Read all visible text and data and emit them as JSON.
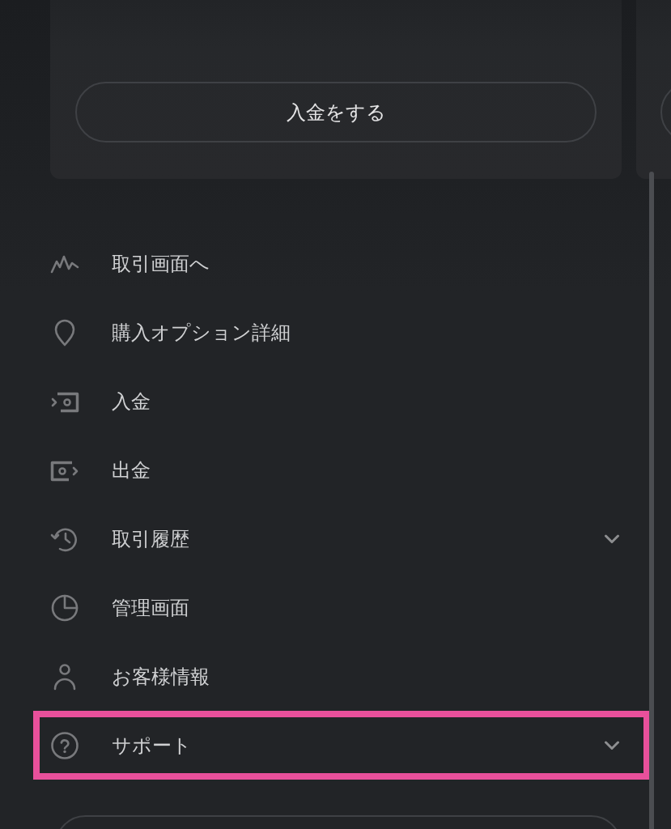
{
  "deposit_card": {
    "button": "入金をする"
  },
  "menu": [
    {
      "label": "取引画面へ",
      "expandable": false,
      "highlighted": false
    },
    {
      "label": "購入オプション詳細",
      "expandable": false,
      "highlighted": false
    },
    {
      "label": "入金",
      "expandable": false,
      "highlighted": false
    },
    {
      "label": "出金",
      "expandable": false,
      "highlighted": false
    },
    {
      "label": "取引履歴",
      "expandable": true,
      "highlighted": false
    },
    {
      "label": "管理画面",
      "expandable": false,
      "highlighted": false
    },
    {
      "label": "お客様情報",
      "expandable": false,
      "highlighted": false
    },
    {
      "label": "サポート",
      "expandable": true,
      "highlighted": true
    }
  ]
}
